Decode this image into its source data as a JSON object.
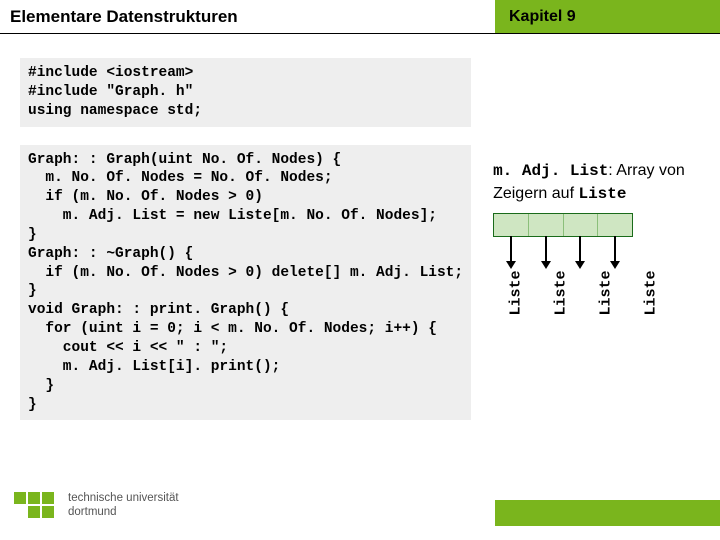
{
  "header": {
    "title_left": "Elementare Datenstrukturen",
    "title_right": "Kapitel 9"
  },
  "code": {
    "block1": "#include <iostream>\n#include \"Graph. h\"\nusing namespace std;",
    "block2": "Graph: : Graph(uint No. Of. Nodes) {\n  m. No. Of. Nodes = No. Of. Nodes;\n  if (m. No. Of. Nodes > 0)\n    m. Adj. List = new Liste[m. No. Of. Nodes];\n}\nGraph: : ~Graph() {\n  if (m. No. Of. Nodes > 0) delete[] m. Adj. List;\n}\nvoid Graph: : print. Graph() {\n  for (uint i = 0; i < m. No. Of. Nodes; i++) {\n    cout << i << \" : \";\n    m. Adj. List[i]. print();\n  }\n}"
  },
  "diagram": {
    "caption_prefix": "m. Adj. List",
    "caption_mid": ": Array von Zeigern auf ",
    "caption_type": "Liste",
    "cell_count": 4,
    "cell_label": "Liste"
  },
  "footer": {
    "uni_line1": "technische universität",
    "uni_line2": "dortmund"
  }
}
